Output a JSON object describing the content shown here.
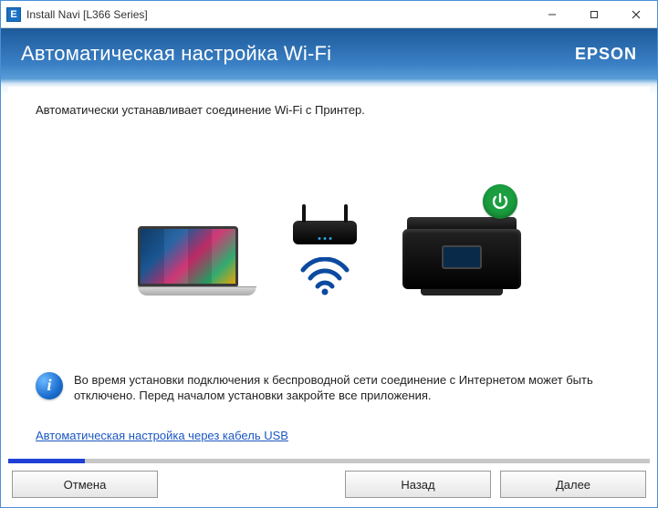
{
  "window": {
    "title": "Install Navi [L366 Series]",
    "minimize_tip": "Minimize",
    "maximize_tip": "Maximize",
    "close_tip": "Close"
  },
  "header": {
    "heading": "Автоматическая настройка Wi-Fi",
    "brand": "EPSON"
  },
  "body": {
    "description": "Автоматически устанавливает соединение Wi-Fi с Принтер.",
    "note": "Во время установки подключения к беспроводной сети соединение с Интернетом может быть отключено. Перед началом установки закройте все приложения.",
    "usb_link": "Автоматическая настройка через кабель USB"
  },
  "buttons": {
    "cancel": "Отмена",
    "back": "Назад",
    "next": "Далее"
  },
  "progress": {
    "percent": 12
  },
  "icons": {
    "app": "E",
    "info": "i",
    "laptop": "laptop-icon",
    "router": "router-icon",
    "wifi": "wifi-icon",
    "printer": "printer-icon",
    "power": "power-icon"
  }
}
